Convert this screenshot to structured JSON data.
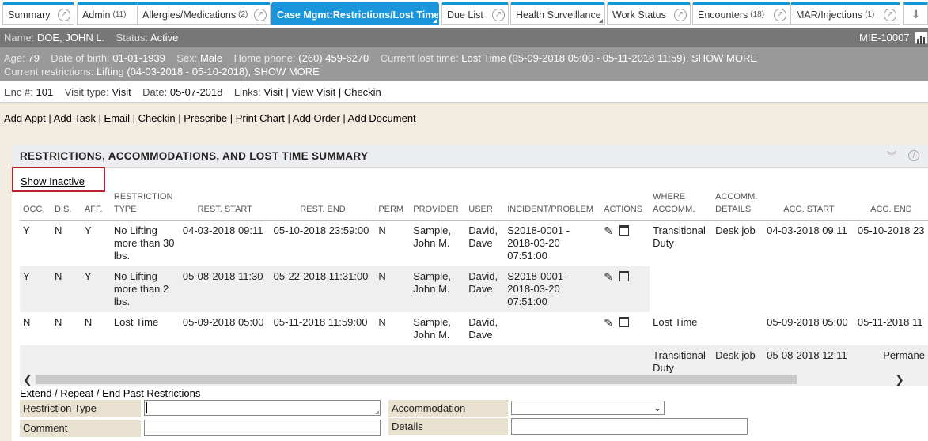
{
  "tabs": [
    {
      "label": "Summary",
      "count": "",
      "icon": "open-icon"
    },
    {
      "label": "Admin",
      "count": "(11)",
      "icon": "open-icon"
    },
    {
      "label": "Allergies/Medications",
      "count": "(2)",
      "icon": "open-icon"
    },
    {
      "label": "Case Mgmt:Restrictions/Lost Time",
      "count": "",
      "icon": ""
    },
    {
      "label": "Due List",
      "count": "",
      "icon": "open-icon"
    },
    {
      "label": "Health Surveillance",
      "count": "",
      "icon": ""
    },
    {
      "label": "Work Status",
      "count": "",
      "icon": "open-icon"
    },
    {
      "label": "Encounters",
      "count": "(18)",
      "icon": "open-icon"
    },
    {
      "label": "MAR/Injections",
      "count": "(1)",
      "icon": "open-icon"
    }
  ],
  "patient": {
    "name_label": "Name:",
    "name": "DOE, JOHN L.",
    "status_label": "Status:",
    "status": "Active",
    "mie": "MIE-10007",
    "age_label": "Age:",
    "age": "79",
    "dob_label": "Date of birth:",
    "dob": "01-01-1939",
    "sex_label": "Sex:",
    "sex": "Male",
    "phone_label": "Home phone:",
    "phone": "(260) 459-6270",
    "lost_label": "Current lost time:",
    "lost": "Lost Time (05-09-2018 05:00 - 05-11-2018 11:59), SHOW MORE",
    "restr_label": "Current restrictions:",
    "restr": "Lifting (04-03-2018 - 05-10-2018), SHOW MORE"
  },
  "encounter": {
    "enc_label": "Enc #:",
    "enc": "101",
    "vt_label": "Visit type:",
    "vt": "Visit",
    "date_label": "Date:",
    "date": "05-07-2018",
    "links_label": "Links:",
    "links": "Visit | View Visit | Checkin"
  },
  "actions": [
    "Add Appt",
    "Add Task",
    "Email",
    "Checkin",
    "Prescribe",
    "Print Chart",
    "Add Order",
    "Add Document"
  ],
  "panel": {
    "title": "RESTRICTIONS, ACCOMMODATIONS, AND LOST TIME SUMMARY",
    "show_inactive": "Show Inactive",
    "extend": "Extend / Repeat / End Past Restrictions"
  },
  "columns": [
    "OCC.",
    "DIS.",
    "AFF.",
    "RESTRICTION TYPE",
    "REST. START",
    "REST. END",
    "PERM",
    "PROVIDER",
    "USER",
    "INCIDENT/PROBLEM",
    "ACTIONS",
    "WHERE ACCOMM.",
    "ACCOMM. DETAILS",
    "ACC. START",
    "ACC. END"
  ],
  "rows": [
    {
      "occ": "Y",
      "dis": "N",
      "aff": "Y",
      "type": "No Lifting more than 30 lbs.",
      "start": "04-03-2018 09:11",
      "end": "05-10-2018 23:59:00",
      "perm": "N",
      "provider": "Sample, John M.",
      "user": "David, Dave",
      "incident": "S2018-0001 - 2018-03-20 07:51:00",
      "where": "Transitional Duty",
      "details": "Desk job",
      "acc_start": "04-03-2018 09:11",
      "acc_end": "05-10-2018 23"
    },
    {
      "occ": "Y",
      "dis": "N",
      "aff": "Y",
      "type": "No Lifting more than 2 lbs.",
      "start": "05-08-2018 11:30",
      "end": "05-22-2018 11:31:00",
      "perm": "N",
      "provider": "Sample, John M.",
      "user": "David, Dave",
      "incident": "S2018-0001 - 2018-03-20 07:51:00",
      "where": "",
      "details": "",
      "acc_start": "",
      "acc_end": ""
    },
    {
      "occ": "N",
      "dis": "N",
      "aff": "N",
      "type": "Lost Time",
      "start": "05-09-2018 05:00",
      "end": "05-11-2018 11:59:00",
      "perm": "N",
      "provider": "Sample, John M.",
      "user": "David, Dave",
      "incident": "",
      "where": "Lost Time",
      "details": "",
      "acc_start": "05-09-2018 05:00",
      "acc_end": "05-11-2018 11"
    },
    {
      "occ": "",
      "dis": "",
      "aff": "",
      "type": "",
      "start": "",
      "end": "",
      "perm": "",
      "provider": "",
      "user": "",
      "incident": "",
      "where": "Transitional Duty",
      "details": "Desk job",
      "acc_start": "05-08-2018 12:11",
      "acc_end": "Permane"
    }
  ],
  "form": {
    "restriction_type": "Restriction Type",
    "comment": "Comment",
    "accommodation": "Accommodation",
    "details": "Details"
  }
}
